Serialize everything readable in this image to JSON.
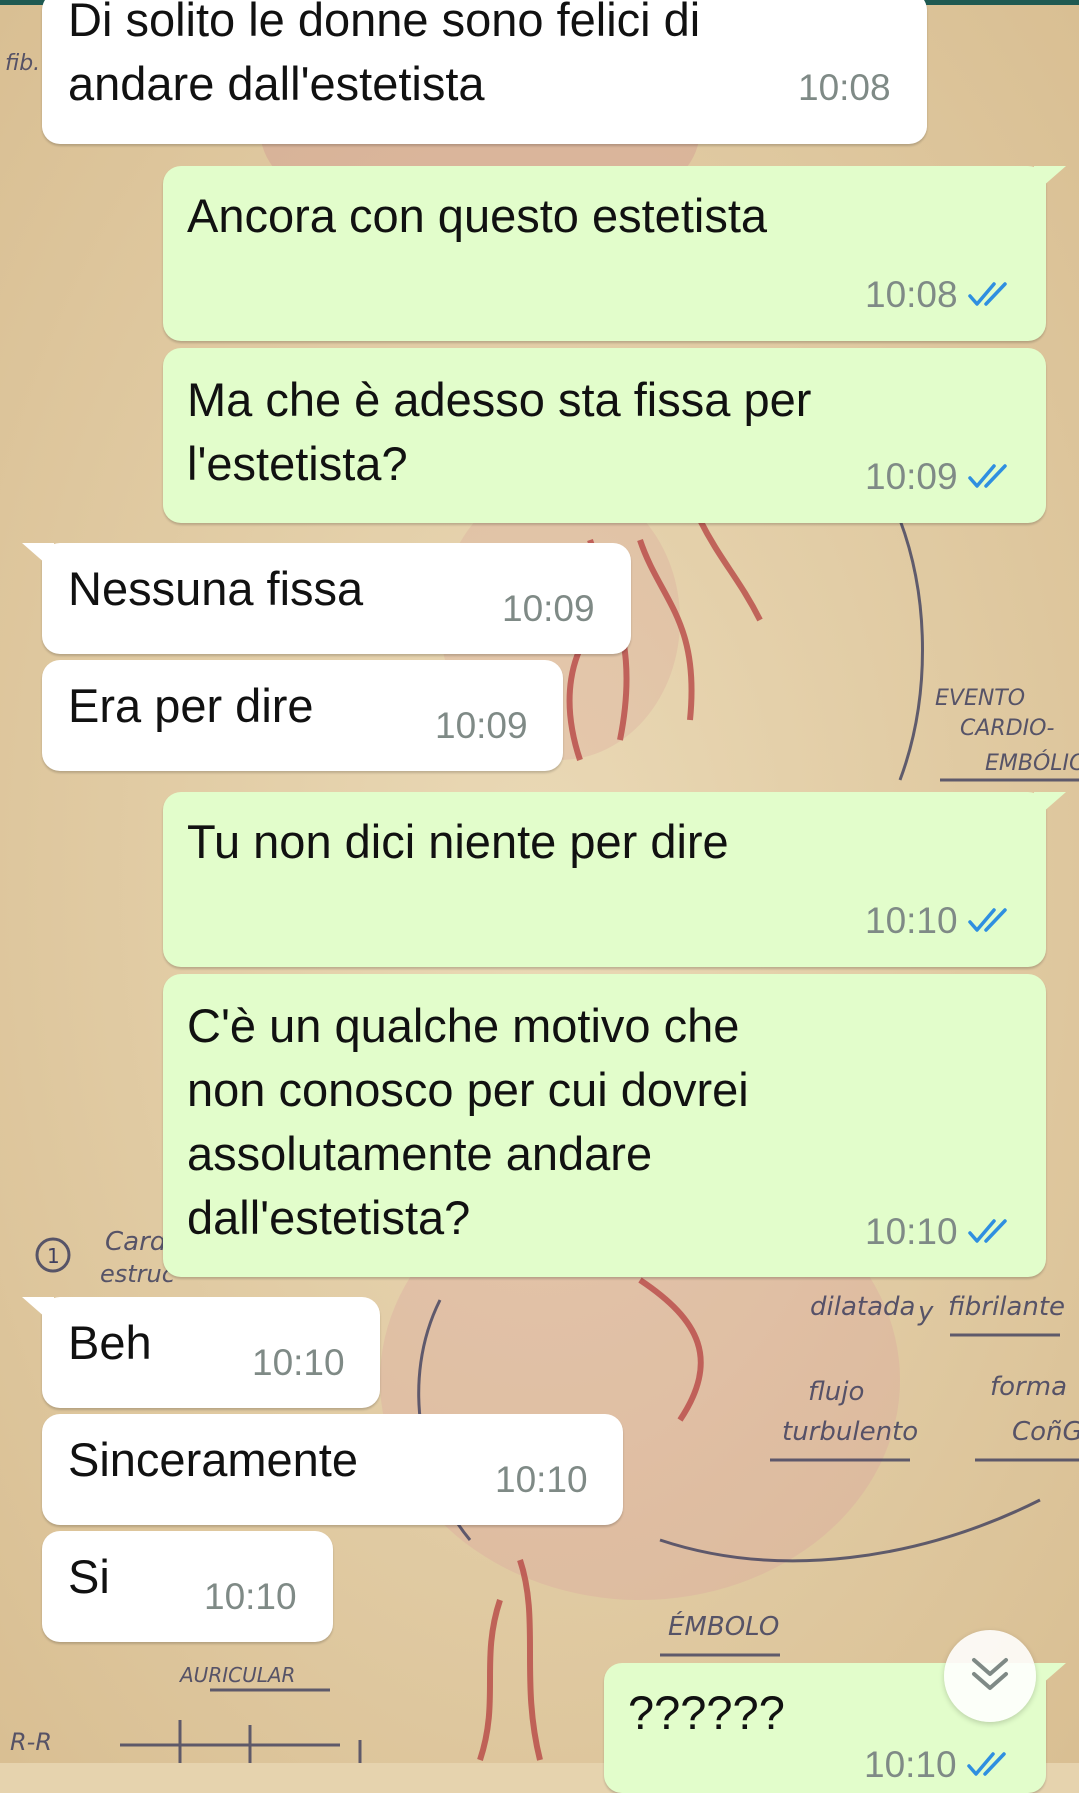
{
  "messages": [
    {
      "direction": "in",
      "text": "Di solito le donne sono felici di\nandare dall'estetista",
      "time": "10:08"
    },
    {
      "direction": "out",
      "text": "Ancora con questo estetista",
      "time": "10:08"
    },
    {
      "direction": "out",
      "text": "Ma che è adesso sta fissa per\nl'estetista?",
      "time": "10:09"
    },
    {
      "direction": "in",
      "text": "Nessuna fissa",
      "time": "10:09"
    },
    {
      "direction": "in",
      "text": "Era per dire",
      "time": "10:09"
    },
    {
      "direction": "out",
      "text": "Tu non dici niente per dire",
      "time": "10:10"
    },
    {
      "direction": "out",
      "text": "C'è un qualche motivo che\nnon conosco per cui dovrei\nassolutamente andare\ndall'estetista?",
      "time": "10:10"
    },
    {
      "direction": "in",
      "text": "Beh",
      "time": "10:10"
    },
    {
      "direction": "in",
      "text": "Sinceramente",
      "time": "10:10"
    },
    {
      "direction": "in",
      "text": "Si",
      "time": "10:10"
    },
    {
      "direction": "out",
      "text": "??????",
      "time": "10:10"
    }
  ],
  "wallpaper": {
    "labels": {
      "evento": "EVENTO",
      "cardio": "CARDIO-",
      "embolic": "EMBÓLIC",
      "dilatada": "dilatada",
      "y": "y",
      "fibrilante": "fibrilante",
      "flujo": "flujo",
      "turbulento": "turbulento",
      "forma": "forma",
      "cono": "CoñG",
      "embolo": "ÉMBOLO",
      "auricular": "AURICULAR",
      "rr": "R-R",
      "card": "Card",
      "estruc": "estruc",
      "num": "1",
      "fib": "fib."
    },
    "colors": {
      "paper": "#e6d3ae",
      "ink": "#3f3f5e",
      "vessel": "#b54040"
    }
  },
  "theme": {
    "incoming_bg": "#ffffff",
    "outgoing_bg": "#e2fdcb",
    "tick_color": "#2f8fe0",
    "time_color": "#7f8a86"
  },
  "scroll_button": {
    "icon": "double-chevron-down-icon"
  }
}
